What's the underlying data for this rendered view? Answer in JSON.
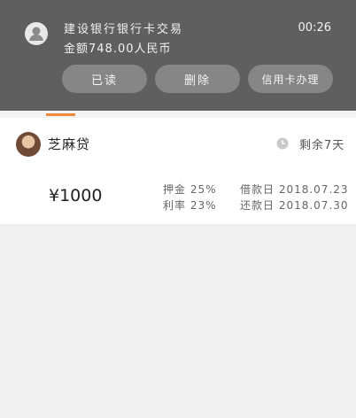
{
  "notification": {
    "title": "建设银行银行卡交易",
    "body": "金额748.00人民币",
    "time": "00:26",
    "actions": [
      "已读",
      "删除",
      "信用卡办理"
    ]
  },
  "loan": {
    "lender": "芝麻贷",
    "remaining": "剩余7天",
    "amount": "¥1000",
    "deposit": "押金 25%",
    "rate": "利率 23%",
    "borrow_date": "借款日 2018.07.23",
    "due_date": "还款日 2018.07.30"
  },
  "icons": {
    "app": "user-icon",
    "clock": "clock-icon"
  },
  "colors": {
    "notification_bg": "#5f5f5f",
    "accent": "#f08a3a",
    "button_bg": "#868686"
  }
}
